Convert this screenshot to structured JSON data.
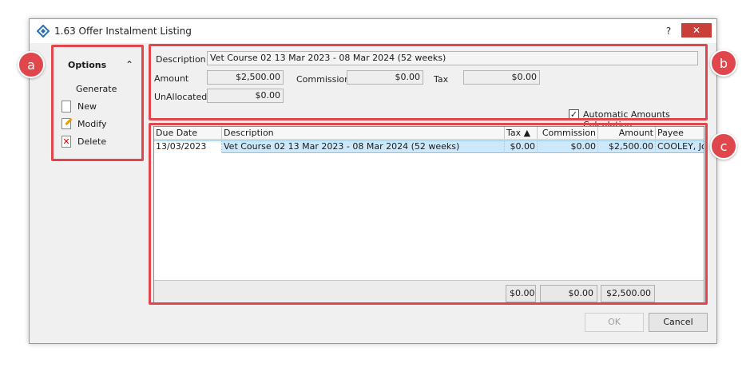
{
  "window": {
    "title": "1.63 Offer Instalment Listing",
    "help": "?",
    "close": "✕"
  },
  "options": {
    "title": "Options",
    "items": [
      {
        "label": "Generate"
      },
      {
        "label": "New"
      },
      {
        "label": "Modify"
      },
      {
        "label": "Delete"
      }
    ]
  },
  "form": {
    "description_label": "Description",
    "description_value": "Vet Course 02  13 Mar 2023 - 08 Mar 2024 (52 weeks)",
    "amount_label": "Amount",
    "amount_value": "$2,500.00",
    "commission_label": "Commission",
    "commission_value": "$0.00",
    "tax_label": "Tax",
    "tax_value": "$0.00",
    "unallocated_label": "UnAllocated",
    "unallocated_value": "$0.00",
    "auto_calc_label": "Automatic Amounts Calculation",
    "auto_calc_checked": "✓"
  },
  "grid": {
    "columns": [
      "Due Date",
      "Description",
      "Tax ▲",
      "Commission",
      "Amount",
      "Payee"
    ],
    "rows": [
      [
        "13/03/2023",
        "Vet Course 02  13 Mar 2023 - 08 Mar 2024 (52 weeks)",
        "$0.00",
        "$0.00",
        "$2,500.00",
        "COOLEY, Jo"
      ]
    ],
    "totals": {
      "tax": "$0.00",
      "commission": "$0.00",
      "amount": "$2,500.00"
    }
  },
  "buttons": {
    "ok": "OK",
    "cancel": "Cancel"
  },
  "annotations": {
    "a": "a",
    "b": "b",
    "c": "c"
  },
  "colors": {
    "highlight": "#e0474c",
    "selected_row": "#cde8fb",
    "close": "#c9403a"
  }
}
